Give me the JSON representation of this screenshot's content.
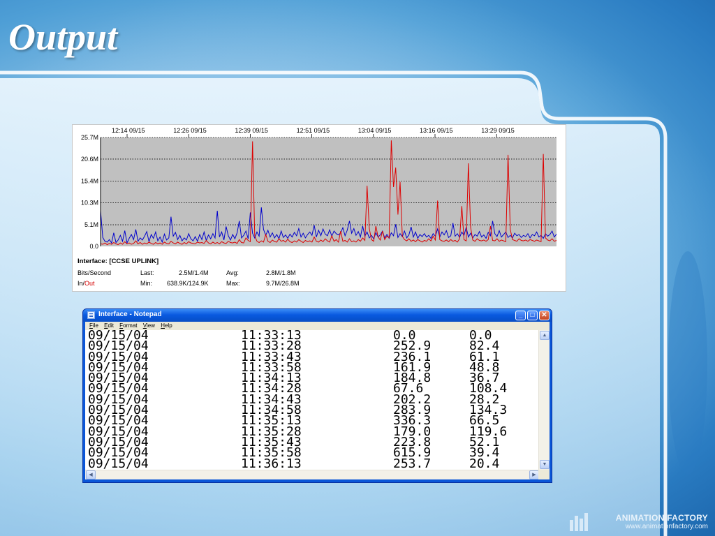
{
  "slide": {
    "title": "Output"
  },
  "chart_data": {
    "type": "line",
    "title": "",
    "x_labels": [
      "12:14 09/15",
      "12:26 09/15",
      "12:39 09/15",
      "12:51 09/15",
      "13:04 09/15",
      "13:16 09/15",
      "13:29 09/15"
    ],
    "y_labels": [
      "25.7M",
      "20.6M",
      "15.4M",
      "10.3M",
      "5.1M",
      "0.0"
    ],
    "ylim": [
      0,
      25.7
    ],
    "y_unit": "M bits/second",
    "grid": "dotted horizontal",
    "plot_background": "#c0c0c0",
    "series": [
      {
        "name": "In",
        "color": "#0000cc",
        "values": [
          8.4,
          2.1,
          1.2,
          1.0,
          1.6,
          0.8,
          3.2,
          0.9,
          1.5,
          2.6,
          1.2,
          3.7,
          0.8,
          1.9,
          2.8,
          1.6,
          4.0,
          1.2,
          2.0,
          1.5,
          2.4,
          3.5,
          1.1,
          2.8,
          1.9,
          3.4,
          1.3,
          2.2,
          1.0,
          2.9,
          1.5,
          2.0,
          7.0,
          2.4,
          3.3,
          1.6,
          2.6,
          1.3,
          2.0,
          1.5,
          3.0,
          1.8,
          1.3,
          2.3,
          1.2,
          2.8,
          1.6,
          3.4,
          1.4,
          2.7,
          1.8,
          3.0,
          2.0,
          8.4,
          2.2,
          3.4,
          1.5,
          4.7,
          2.5,
          1.5,
          2.8,
          1.8,
          3.2,
          6.0,
          2.0,
          2.6,
          3.6,
          1.8,
          8.0,
          3.1,
          2.0,
          3.4,
          2.4,
          9.2,
          4.0,
          2.6,
          3.8,
          2.2,
          3.2,
          2.0,
          2.8,
          1.8,
          3.6,
          2.1,
          2.7,
          1.9,
          2.9,
          2.2,
          3.3,
          2.5,
          4.2,
          2.2,
          3.1,
          2.0,
          2.8,
          3.4,
          2.6,
          5.0,
          2.2,
          3.8,
          2.5,
          4.1,
          2.9,
          2.5,
          3.9,
          2.4,
          3.6,
          3.0,
          2.7,
          3.2,
          4.4,
          2.5,
          3.8,
          6.0,
          3.1,
          4.2,
          2.6,
          3.5,
          2.2,
          4.8,
          2.4,
          3.4,
          2.0,
          2.6,
          1.8,
          3.2,
          2.2,
          2.7,
          3.6,
          2.0,
          2.8,
          1.9,
          3.2,
          2.5,
          5.2,
          2.1,
          3.0,
          2.3,
          3.6,
          2.0,
          2.7,
          4.6,
          2.2,
          3.4,
          1.9,
          2.8,
          2.3,
          3.0,
          2.2,
          2.6,
          1.9,
          3.0,
          2.4,
          4.1,
          2.2,
          3.4,
          2.7,
          3.7,
          2.1,
          2.5,
          5.5,
          2.4,
          3.0,
          2.1,
          3.4,
          2.6,
          4.5,
          2.2,
          3.1,
          2.0,
          2.8,
          2.4,
          3.5,
          2.2,
          2.7,
          1.9,
          3.3,
          2.5,
          6.0,
          3.0,
          2.3,
          3.7,
          2.2,
          2.8,
          3.4,
          2.1,
          2.6,
          2.0,
          3.1,
          2.5,
          2.8,
          2.1,
          2.6,
          2.3,
          3.0,
          2.0,
          2.8,
          2.5,
          3.4,
          2.2,
          2.6,
          1.9,
          3.0,
          2.4,
          2.8,
          3.6,
          2.2,
          2.9
        ]
      },
      {
        "name": "Out",
        "color": "#dd0000",
        "values": [
          0.6,
          0.5,
          0.8,
          0.4,
          0.7,
          0.5,
          0.9,
          0.6,
          0.4,
          0.8,
          0.5,
          1.1,
          0.6,
          0.8,
          0.5,
          0.7,
          1.3,
          0.6,
          0.9,
          0.5,
          0.8,
          0.6,
          1.0,
          0.7,
          0.5,
          0.9,
          0.6,
          0.8,
          0.5,
          1.0,
          0.7,
          0.6,
          1.2,
          0.8,
          0.6,
          1.0,
          0.7,
          0.5,
          0.9,
          0.6,
          1.1,
          0.8,
          0.7,
          0.6,
          1.0,
          0.8,
          0.9,
          0.7,
          1.4,
          0.8,
          0.6,
          1.0,
          0.7,
          0.9,
          0.6,
          1.1,
          0.8,
          0.7,
          1.2,
          0.9,
          0.8,
          1.0,
          0.7,
          1.6,
          0.9,
          0.8,
          2.0,
          1.4,
          1.1,
          24.8,
          2.5,
          1.2,
          0.9,
          1.3,
          1.0,
          2.8,
          1.2,
          0.9,
          1.5,
          1.1,
          1.0,
          1.8,
          1.2,
          1.4,
          1.0,
          1.7,
          1.1,
          0.9,
          1.3,
          1.0,
          1.6,
          1.2,
          0.9,
          1.4,
          1.1,
          1.3,
          1.0,
          2.2,
          1.2,
          1.0,
          1.5,
          1.1,
          1.8,
          1.3,
          1.0,
          2.5,
          1.2,
          1.6,
          1.0,
          3.6,
          1.2,
          1.4,
          1.0,
          1.8,
          1.1,
          1.3,
          1.0,
          1.6,
          1.2,
          2.0,
          1.4,
          14.3,
          4.2,
          1.6,
          1.2,
          4.8,
          2.2,
          1.5,
          3.6,
          1.6,
          2.4,
          2.0,
          25.0,
          14.0,
          18.6,
          7.5,
          15.2,
          2.4,
          1.6,
          1.3,
          1.8,
          1.2,
          1.5,
          1.1,
          1.6,
          1.3,
          1.0,
          1.4,
          1.2,
          1.8,
          1.3,
          2.4,
          1.5,
          10.8,
          1.6,
          1.3,
          1.2,
          1.5,
          1.1,
          1.6,
          1.2,
          1.4,
          1.0,
          1.8,
          9.5,
          1.6,
          1.3,
          19.6,
          4.5,
          1.5,
          1.2,
          1.8,
          1.4,
          1.3,
          1.5,
          1.2,
          1.6,
          4.8,
          1.4,
          1.3,
          1.8,
          1.2,
          1.5,
          1.3,
          1.1,
          21.6,
          4.0,
          1.6,
          1.4,
          1.2,
          1.8,
          1.4,
          1.3,
          1.5,
          1.2,
          1.6,
          1.4,
          1.2,
          1.5,
          1.3,
          1.1,
          21.8,
          2.0,
          1.5,
          1.3,
          1.8,
          1.2,
          1.4
        ]
      }
    ]
  },
  "chart_stats": {
    "interface": "Interface: [CCSE UPLINK]",
    "row1": {
      "label": "Bits/Second",
      "key1": "Last:",
      "val1": "2.5M/1.4M",
      "key2": "Avg:",
      "val2": "2.8M/1.8M"
    },
    "row2": {
      "label_in": "In/",
      "label_out": "Out",
      "key1": "Min:",
      "val1": "638.9K/124.9K",
      "key2": "Max:",
      "val2": "9.7M/26.8M"
    }
  },
  "notepad": {
    "title": "Interface - Notepad",
    "menu": [
      "File",
      "Edit",
      "Format",
      "View",
      "Help"
    ],
    "rows": [
      [
        "09/15/04",
        "11:33:13",
        "0.0",
        "0.0"
      ],
      [
        "09/15/04",
        "11:33:28",
        "252.9",
        "82.4"
      ],
      [
        "09/15/04",
        "11:33:43",
        "236.1",
        "61.1"
      ],
      [
        "09/15/04",
        "11:33:58",
        "161.9",
        "48.8"
      ],
      [
        "09/15/04",
        "11:34:13",
        "184.8",
        "36.7"
      ],
      [
        "09/15/04",
        "11:34:28",
        "67.6",
        "108.4"
      ],
      [
        "09/15/04",
        "11:34:43",
        "202.2",
        "28.2"
      ],
      [
        "09/15/04",
        "11:34:58",
        "283.9",
        "134.3"
      ],
      [
        "09/15/04",
        "11:35:13",
        "336.3",
        "66.5"
      ],
      [
        "09/15/04",
        "11:35:28",
        "179.0",
        "119.6"
      ],
      [
        "09/15/04",
        "11:35:43",
        "223.8",
        "52.1"
      ],
      [
        "09/15/04",
        "11:35:58",
        "615.9",
        "39.4"
      ],
      [
        "09/15/04",
        "11:36:13",
        "253.7",
        "20.4"
      ]
    ]
  },
  "brand": {
    "name": "ANIMATION FACTORY",
    "url": "www.animationfactory.com"
  }
}
